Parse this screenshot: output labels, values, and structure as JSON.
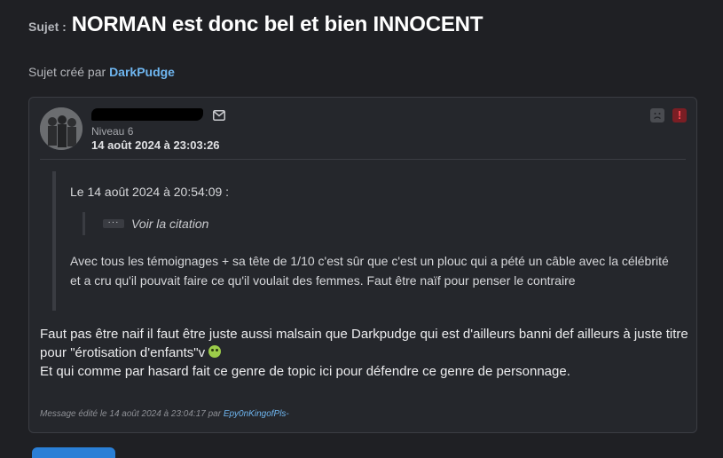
{
  "header": {
    "subject_label": "Sujet :",
    "subject_title": "NORMAN est donc bel et bien INNOCENT",
    "created_prefix": "Sujet créé par",
    "created_author": "DarkPudge"
  },
  "post": {
    "level": "Niveau 6",
    "date": "14 août 2024 à 23:03:26",
    "quote": {
      "header": "Le 14 août 2024 à 20:54:09 :",
      "dots": "···",
      "show_citation": "Voir la citation",
      "text": "Avec tous les témoignages + sa tête de 1/10 c'est sûr que c'est un plouc qui a pété un câble avec la célébrité et a cru qu'il pouvait faire ce qu'il voulait des femmes. Faut être naïf pour penser le contraire"
    },
    "body": {
      "line1": "Faut pas être naif il faut être juste aussi malsain que Darkpudge qui est d'ailleurs banni def ailleurs à juste titre pour \"érotisation d'enfants\"v",
      "line2": "Et qui comme par hasard fait ce genre de topic ici pour défendre ce genre de personnage."
    },
    "edited": {
      "prefix": "Message édité le 14 août 2024 à 23:04:17 par",
      "editor": "Epy0nKingofPls-"
    },
    "alert_symbol": "!",
    "icons": [
      "mail-icon",
      "sad-face-icon",
      "alert-icon",
      "emoji-icon"
    ]
  }
}
